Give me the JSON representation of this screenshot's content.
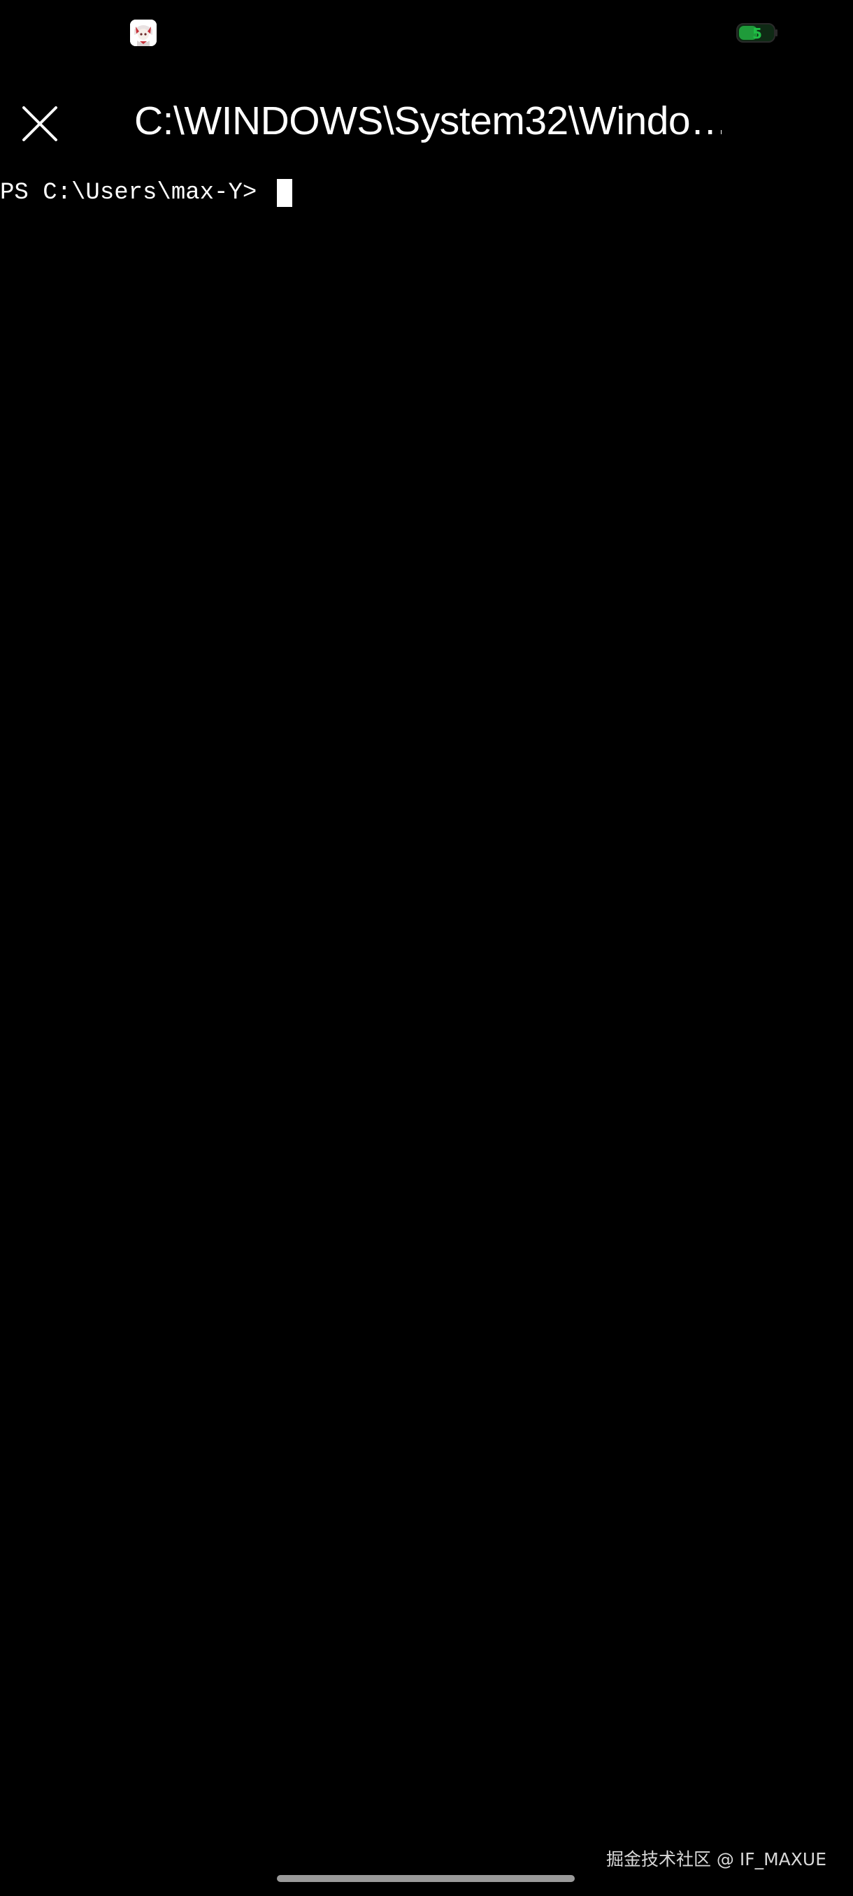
{
  "status_bar": {
    "app_icon": "anime-avatar-icon",
    "battery": {
      "icon": "battery-icon",
      "level_text": "5",
      "color": "#1f9b3a"
    }
  },
  "window": {
    "close_icon": "close-icon",
    "title": "C:\\WINDOWS\\System32\\Windo…"
  },
  "terminal": {
    "prompt": "PS C:\\Users\\max-Y> "
  },
  "watermark": {
    "text": "掘金技术社区 @ IF_MAXUE"
  },
  "colors": {
    "background": "#000000",
    "text": "#ffffff"
  }
}
